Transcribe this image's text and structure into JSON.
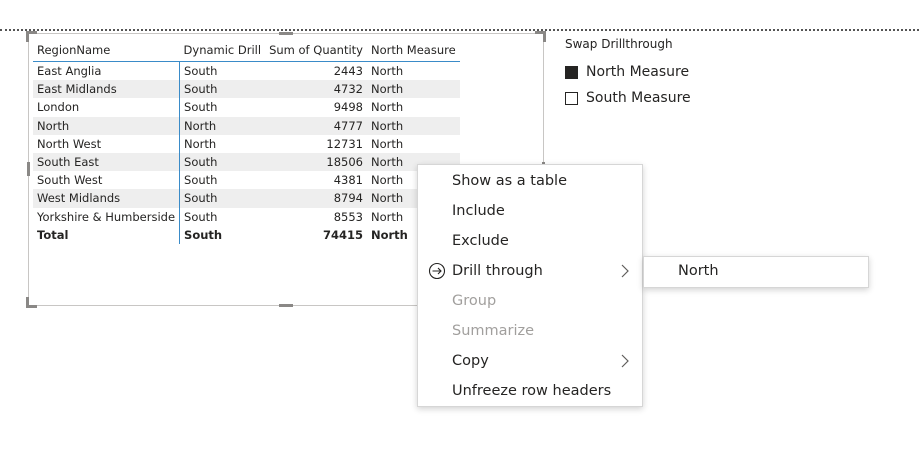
{
  "table": {
    "columns": [
      "RegionName",
      "Dynamic Drill",
      "Sum of Quantity",
      "North Measure"
    ],
    "rows": [
      [
        "East Anglia",
        "South",
        "2443",
        "North"
      ],
      [
        "East Midlands",
        "South",
        "4732",
        "North"
      ],
      [
        "London",
        "South",
        "9498",
        "North"
      ],
      [
        "North",
        "North",
        "4777",
        "North"
      ],
      [
        "North West",
        "North",
        "12731",
        "North"
      ],
      [
        "South East",
        "South",
        "18506",
        "North"
      ],
      [
        "South West",
        "South",
        "4381",
        "North"
      ],
      [
        "West Midlands",
        "South",
        "8794",
        "North"
      ],
      [
        "Yorkshire & Humberside",
        "South",
        "8553",
        "North"
      ]
    ],
    "total": [
      "Total",
      "South",
      "74415",
      "North"
    ]
  },
  "slicer": {
    "title": "Swap Drillthrough",
    "options": [
      {
        "label": "North Measure",
        "checked": true
      },
      {
        "label": "South Measure",
        "checked": false
      }
    ]
  },
  "context_menu": {
    "items": [
      {
        "label": "Show as a table",
        "disabled": false
      },
      {
        "label": "Include",
        "disabled": false
      },
      {
        "label": "Exclude",
        "disabled": false
      },
      {
        "label": "Drill through",
        "disabled": false,
        "icon": "drillthrough-icon",
        "submenu": true
      },
      {
        "label": "Group",
        "disabled": true
      },
      {
        "label": "Summarize",
        "disabled": true
      },
      {
        "label": "Copy",
        "disabled": false,
        "submenu": true
      },
      {
        "label": "Unfreeze row headers",
        "disabled": false
      }
    ]
  },
  "submenu": {
    "items": [
      "North"
    ]
  },
  "colors": {
    "accent": "#3a8bc8",
    "row_alt": "#eeeeee",
    "text": "#252423",
    "disabled": "#a19f9d"
  }
}
